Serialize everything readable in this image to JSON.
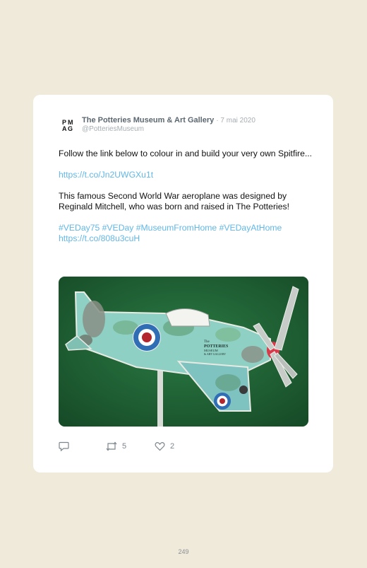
{
  "tweet": {
    "author_name": "The Potteries Museum & Art Gallery",
    "date": "· 7 mai 2020",
    "handle": "@PotteriesMuseum",
    "avatar_icon": "pmag-logo-icon",
    "paragraphs": {
      "p1": "Follow the link below to colour in and build your very own Spitfire...",
      "link1": "https://t.co/Jn2UWGXu1t",
      "p2": "This famous Second World War aeroplane was designed by Reginald Mitchell, who was born and raised in The Potteries!",
      "hashtags": "#VEDay75 #VEDay #MuseumFromHome #VEDayAtHome",
      "link2": "https://t.co/808u3cuH"
    },
    "media": {
      "description_icon": "paper-spitfire-photo",
      "decal_lines": [
        "The",
        "POTTERIES",
        "MUSEUM",
        "& ART GALLERY"
      ]
    },
    "actions": {
      "reply_count": "",
      "retweet_count": "5",
      "like_count": "2"
    },
    "colors": {
      "link": "#62b7e6",
      "background": "#f0eadb",
      "card": "#ffffff"
    }
  },
  "page": {
    "number": "249"
  }
}
